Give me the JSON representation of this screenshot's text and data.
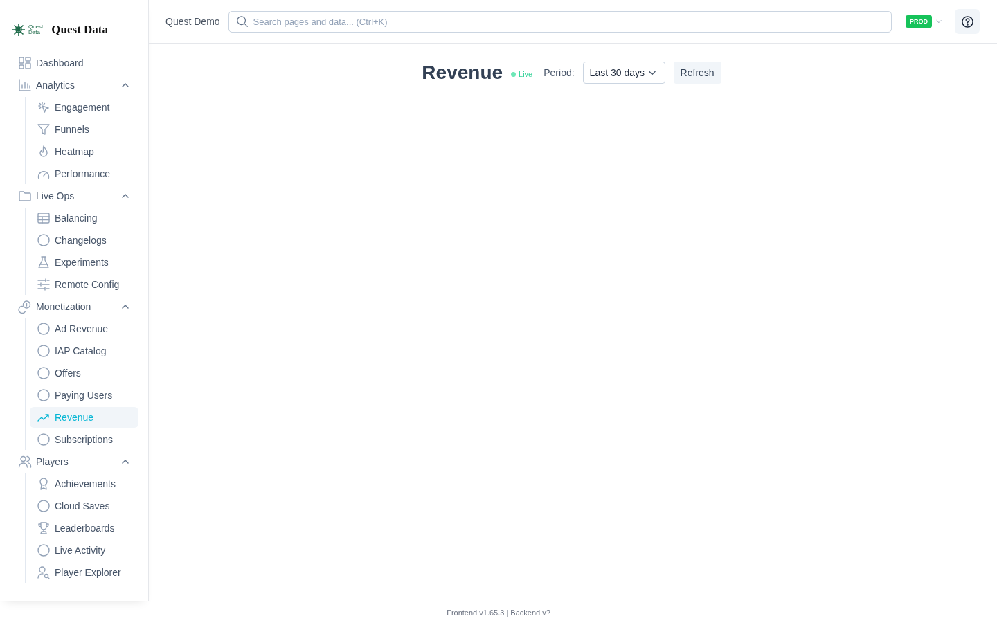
{
  "logo": {
    "mark_text_top": "Quest",
    "mark_text_bottom": "Data",
    "name": "Quest Data"
  },
  "sidebar": {
    "items": [
      {
        "label": "Dashboard",
        "kind": "grid",
        "selected": false
      },
      {
        "label": "Analytics",
        "kind": "bars",
        "expanded": true,
        "selected": false,
        "children": [
          {
            "label": "Engagement",
            "kind": "cursor",
            "selected": false
          },
          {
            "label": "Funnels",
            "kind": "funnel",
            "selected": false
          },
          {
            "label": "Heatmap",
            "kind": "flame",
            "selected": false
          },
          {
            "label": "Performance",
            "kind": "gauge",
            "selected": false
          }
        ]
      },
      {
        "label": "Live Ops",
        "kind": "folder",
        "expanded": true,
        "selected": false,
        "children": [
          {
            "label": "Balancing",
            "kind": "table",
            "selected": false
          },
          {
            "label": "Changelogs",
            "kind": "circle",
            "selected": false
          },
          {
            "label": "Experiments",
            "kind": "flask",
            "selected": false
          },
          {
            "label": "Remote Config",
            "kind": "sliders",
            "selected": false
          }
        ]
      },
      {
        "label": "Monetization",
        "kind": "coins",
        "expanded": true,
        "selected": false,
        "children": [
          {
            "label": "Ad Revenue",
            "kind": "circle",
            "selected": false
          },
          {
            "label": "IAP Catalog",
            "kind": "circle",
            "selected": false
          },
          {
            "label": "Offers",
            "kind": "circle",
            "selected": false
          },
          {
            "label": "Paying Users",
            "kind": "circle",
            "selected": false
          },
          {
            "label": "Revenue",
            "kind": "trend",
            "selected": true
          },
          {
            "label": "Subscriptions",
            "kind": "circle",
            "selected": false
          }
        ]
      },
      {
        "label": "Players",
        "kind": "users",
        "expanded": true,
        "selected": false,
        "children": [
          {
            "label": "Achievements",
            "kind": "award",
            "selected": false
          },
          {
            "label": "Cloud Saves",
            "kind": "circle",
            "selected": false
          },
          {
            "label": "Leaderboards",
            "kind": "trophy",
            "selected": false
          },
          {
            "label": "Live Activity",
            "kind": "circle",
            "selected": false
          },
          {
            "label": "Player Explorer",
            "kind": "usersearch",
            "selected": false
          }
        ]
      }
    ]
  },
  "topbar": {
    "project": "Quest Demo",
    "search": {
      "placeholder": "Search pages and data... (Ctrl+K)"
    },
    "environment": "PROD"
  },
  "page": {
    "title": "Revenue",
    "status": "Live",
    "period_label": "Period:",
    "period": "Last 30 days",
    "refresh": "Refresh"
  },
  "footer": "Frontend v1.65.3 | Backend v?"
}
